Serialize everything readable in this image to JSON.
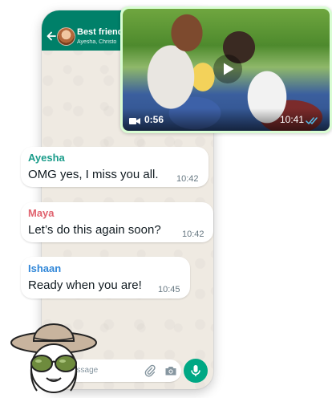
{
  "chat": {
    "title": "Best friends",
    "members": "Ayesha, Christo"
  },
  "video": {
    "duration": "0:56",
    "time": "10:41"
  },
  "messages": [
    {
      "sender": "Ayesha",
      "sender_color": "#1a9c8a",
      "text": "OMG yes, I miss you all.",
      "time": "10:42"
    },
    {
      "sender": "Maya",
      "sender_color": "#e0626e",
      "text": "Let’s do this again soon?",
      "time": "10:42"
    },
    {
      "sender": "Ishaan",
      "sender_color": "#3187d8",
      "text": "Ready when you are!",
      "time": "10:45"
    }
  ],
  "input": {
    "placeholder": "essage"
  },
  "colors": {
    "header": "#008069",
    "accent": "#00a884",
    "bubble_out": "#d9fdd3",
    "ticks": "#53bdeb"
  }
}
